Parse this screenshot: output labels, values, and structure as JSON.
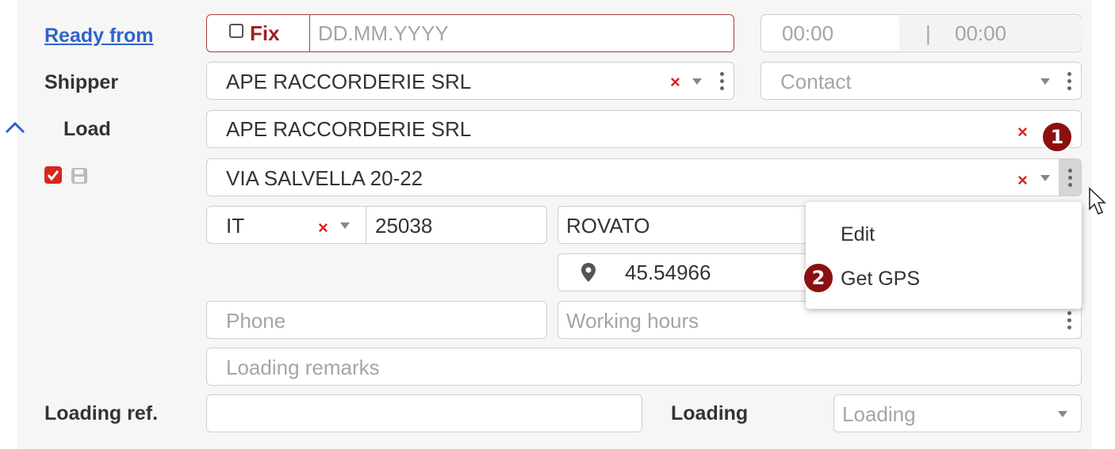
{
  "ready_from": {
    "label": "Ready from",
    "fix_label": "Fix",
    "date_placeholder": "DD.MM.YYYY",
    "time_from": "00:00",
    "time_separator": "|",
    "time_to": "00:00"
  },
  "shipper": {
    "label": "Shipper",
    "value": "APE RACCORDERIE SRL",
    "contact_placeholder": "Contact"
  },
  "load": {
    "label": "Load",
    "name": "APE RACCORDERIE SRL",
    "address": "VIA SALVELLA 20-22",
    "country": "IT",
    "zip": "25038",
    "city": "ROVATO",
    "gps": "45.54966",
    "phone_placeholder": "Phone",
    "hours_placeholder": "Working hours",
    "remarks_placeholder": "Loading remarks"
  },
  "loading_ref": {
    "label": "Loading ref.",
    "loading_label": "Loading",
    "loading_placeholder": "Loading"
  },
  "context_menu": {
    "items": [
      "Edit",
      "Get GPS"
    ]
  },
  "badges": [
    "1",
    "2"
  ],
  "colors": {
    "accent_red": "#8b1111",
    "link_blue": "#2f63c9",
    "clear_x": "#e02020"
  }
}
